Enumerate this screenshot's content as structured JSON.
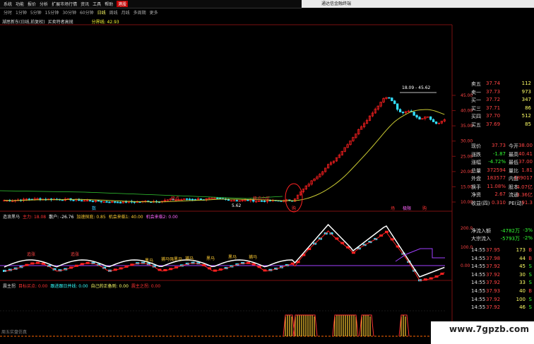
{
  "menu": [
    "系统",
    "功能",
    "报价",
    "分析",
    "扩展市场行情",
    "资讯",
    "工具",
    "帮助",
    "港股"
  ],
  "window_title": "通达信金融终端",
  "periods": [
    "分时",
    "1分钟",
    "5分钟",
    "15分钟",
    "30分钟",
    "60分钟",
    "日线",
    "周线",
    "月线",
    "多周期",
    "更多"
  ],
  "active_period": "日线",
  "main_info": {
    "stock": "湖思新东(日线,前复权)",
    "indicator": "买卖特者高抛",
    "vol_label": "分界线: 42.93"
  },
  "price_axis": [
    "45.00",
    "40.00",
    "35.00",
    "30.00",
    "25.00",
    "20.00",
    "15.00",
    "10.00"
  ],
  "annotations": {
    "high_marker": "18.09 - 45.62",
    "low_price": "5.62",
    "tag1": "极点",
    "tag2": "极点小买",
    "label_left": "数",
    "label_mid": "购",
    "label_mid2": "场",
    "label_mid3": "极限",
    "label_mid4": "购"
  },
  "panel2": {
    "name": "造浪黑马",
    "v1": "主力: 18.08",
    "v2": "散户: -26.76",
    "v3": "加速探底: 0.85",
    "v4": "机会来临1: 40.00",
    "v5": "机会来临2: 0.00"
  },
  "panel2_axis": [
    "200.0",
    "100.0",
    "0.00"
  ],
  "panel2_tags": [
    "追涨",
    "追涨",
    "黑马",
    "捕马强黑马",
    "捕马",
    "黑马",
    "黑马",
    "捕马"
  ],
  "panel3": {
    "name": "震主拐",
    "v1": "目标买点: 0.00",
    "v2": "跟进跟日并线: 0.00",
    "v3": "自己的正备则: 0.00",
    "v4": "震主之拐: 0.00"
  },
  "bottom_tab": "周五实盘仿真",
  "quote": {
    "asks": [
      {
        "label": "卖五",
        "price": "37.74",
        "vol": "112"
      },
      {
        "label": "卖一",
        "price": "37.73",
        "vol": "973"
      },
      {
        "label": "买一",
        "price": "37.72",
        "vol": "347"
      },
      {
        "label": "买三",
        "price": "37.71",
        "vol": "86"
      },
      {
        "label": "买四",
        "price": "37.70",
        "vol": "512"
      },
      {
        "label": "买五",
        "price": "37.69",
        "vol": "85"
      }
    ],
    "stats": [
      {
        "l1": "现价",
        "v1": "37.73",
        "l2": "今开",
        "v2": "38.00"
      },
      {
        "l1": "涨跌",
        "v1": "-1.87",
        "l2": "最高",
        "v2": "40.41"
      },
      {
        "l1": "涨幅",
        "v1": "-4.72%",
        "l2": "最低",
        "v2": "37.00"
      },
      {
        "l1": "总量",
        "v1": "372594",
        "l2": "量比",
        "v2": "1.81"
      },
      {
        "l1": "外盘",
        "v1": "183577",
        "l2": "内盘",
        "v2": "189017"
      },
      {
        "l1": "换手",
        "v1": "11.08%",
        "l2": "股本",
        "v2": "4.07亿"
      },
      {
        "l1": "净资",
        "v1": "2.67",
        "l2": "流通",
        "v2": "3.36亿"
      },
      {
        "l1": "收益(四)",
        "v1": "0.310",
        "l2": "PE(动)",
        "v2": "91.3"
      }
    ],
    "flow": [
      {
        "l": "净流入额",
        "v": "-4782万",
        "p": "-3%"
      },
      {
        "l": "大宗流入",
        "v": "-5793万",
        "p": "-2%"
      }
    ],
    "ticks": [
      {
        "t": "14:55",
        "p": "37.95",
        "v": "173",
        "d": "B"
      },
      {
        "t": "14:55",
        "p": "37.98",
        "v": "44",
        "d": "B"
      },
      {
        "t": "14:55",
        "p": "37.92",
        "v": "45",
        "d": "S"
      },
      {
        "t": "14:55",
        "p": "37.92",
        "v": "30",
        "d": "S"
      },
      {
        "t": "14:55",
        "p": "37.92",
        "v": "33",
        "d": "S"
      },
      {
        "t": "14:55",
        "p": "37.93",
        "v": "40",
        "d": "B"
      },
      {
        "t": "14:55",
        "p": "37.92",
        "v": "100",
        "d": "S"
      },
      {
        "t": "14:55",
        "p": "37.92",
        "v": "46",
        "d": "S"
      }
    ]
  },
  "watermark": "www.7gpzb.com",
  "colors": {
    "up": "#ff2020",
    "down": "#33e0ff",
    "ma": "#cccc33",
    "white_line": "#ffffff",
    "red_line": "#ff2020",
    "purple": "#a040ff",
    "gold": "#ffcc33"
  }
}
